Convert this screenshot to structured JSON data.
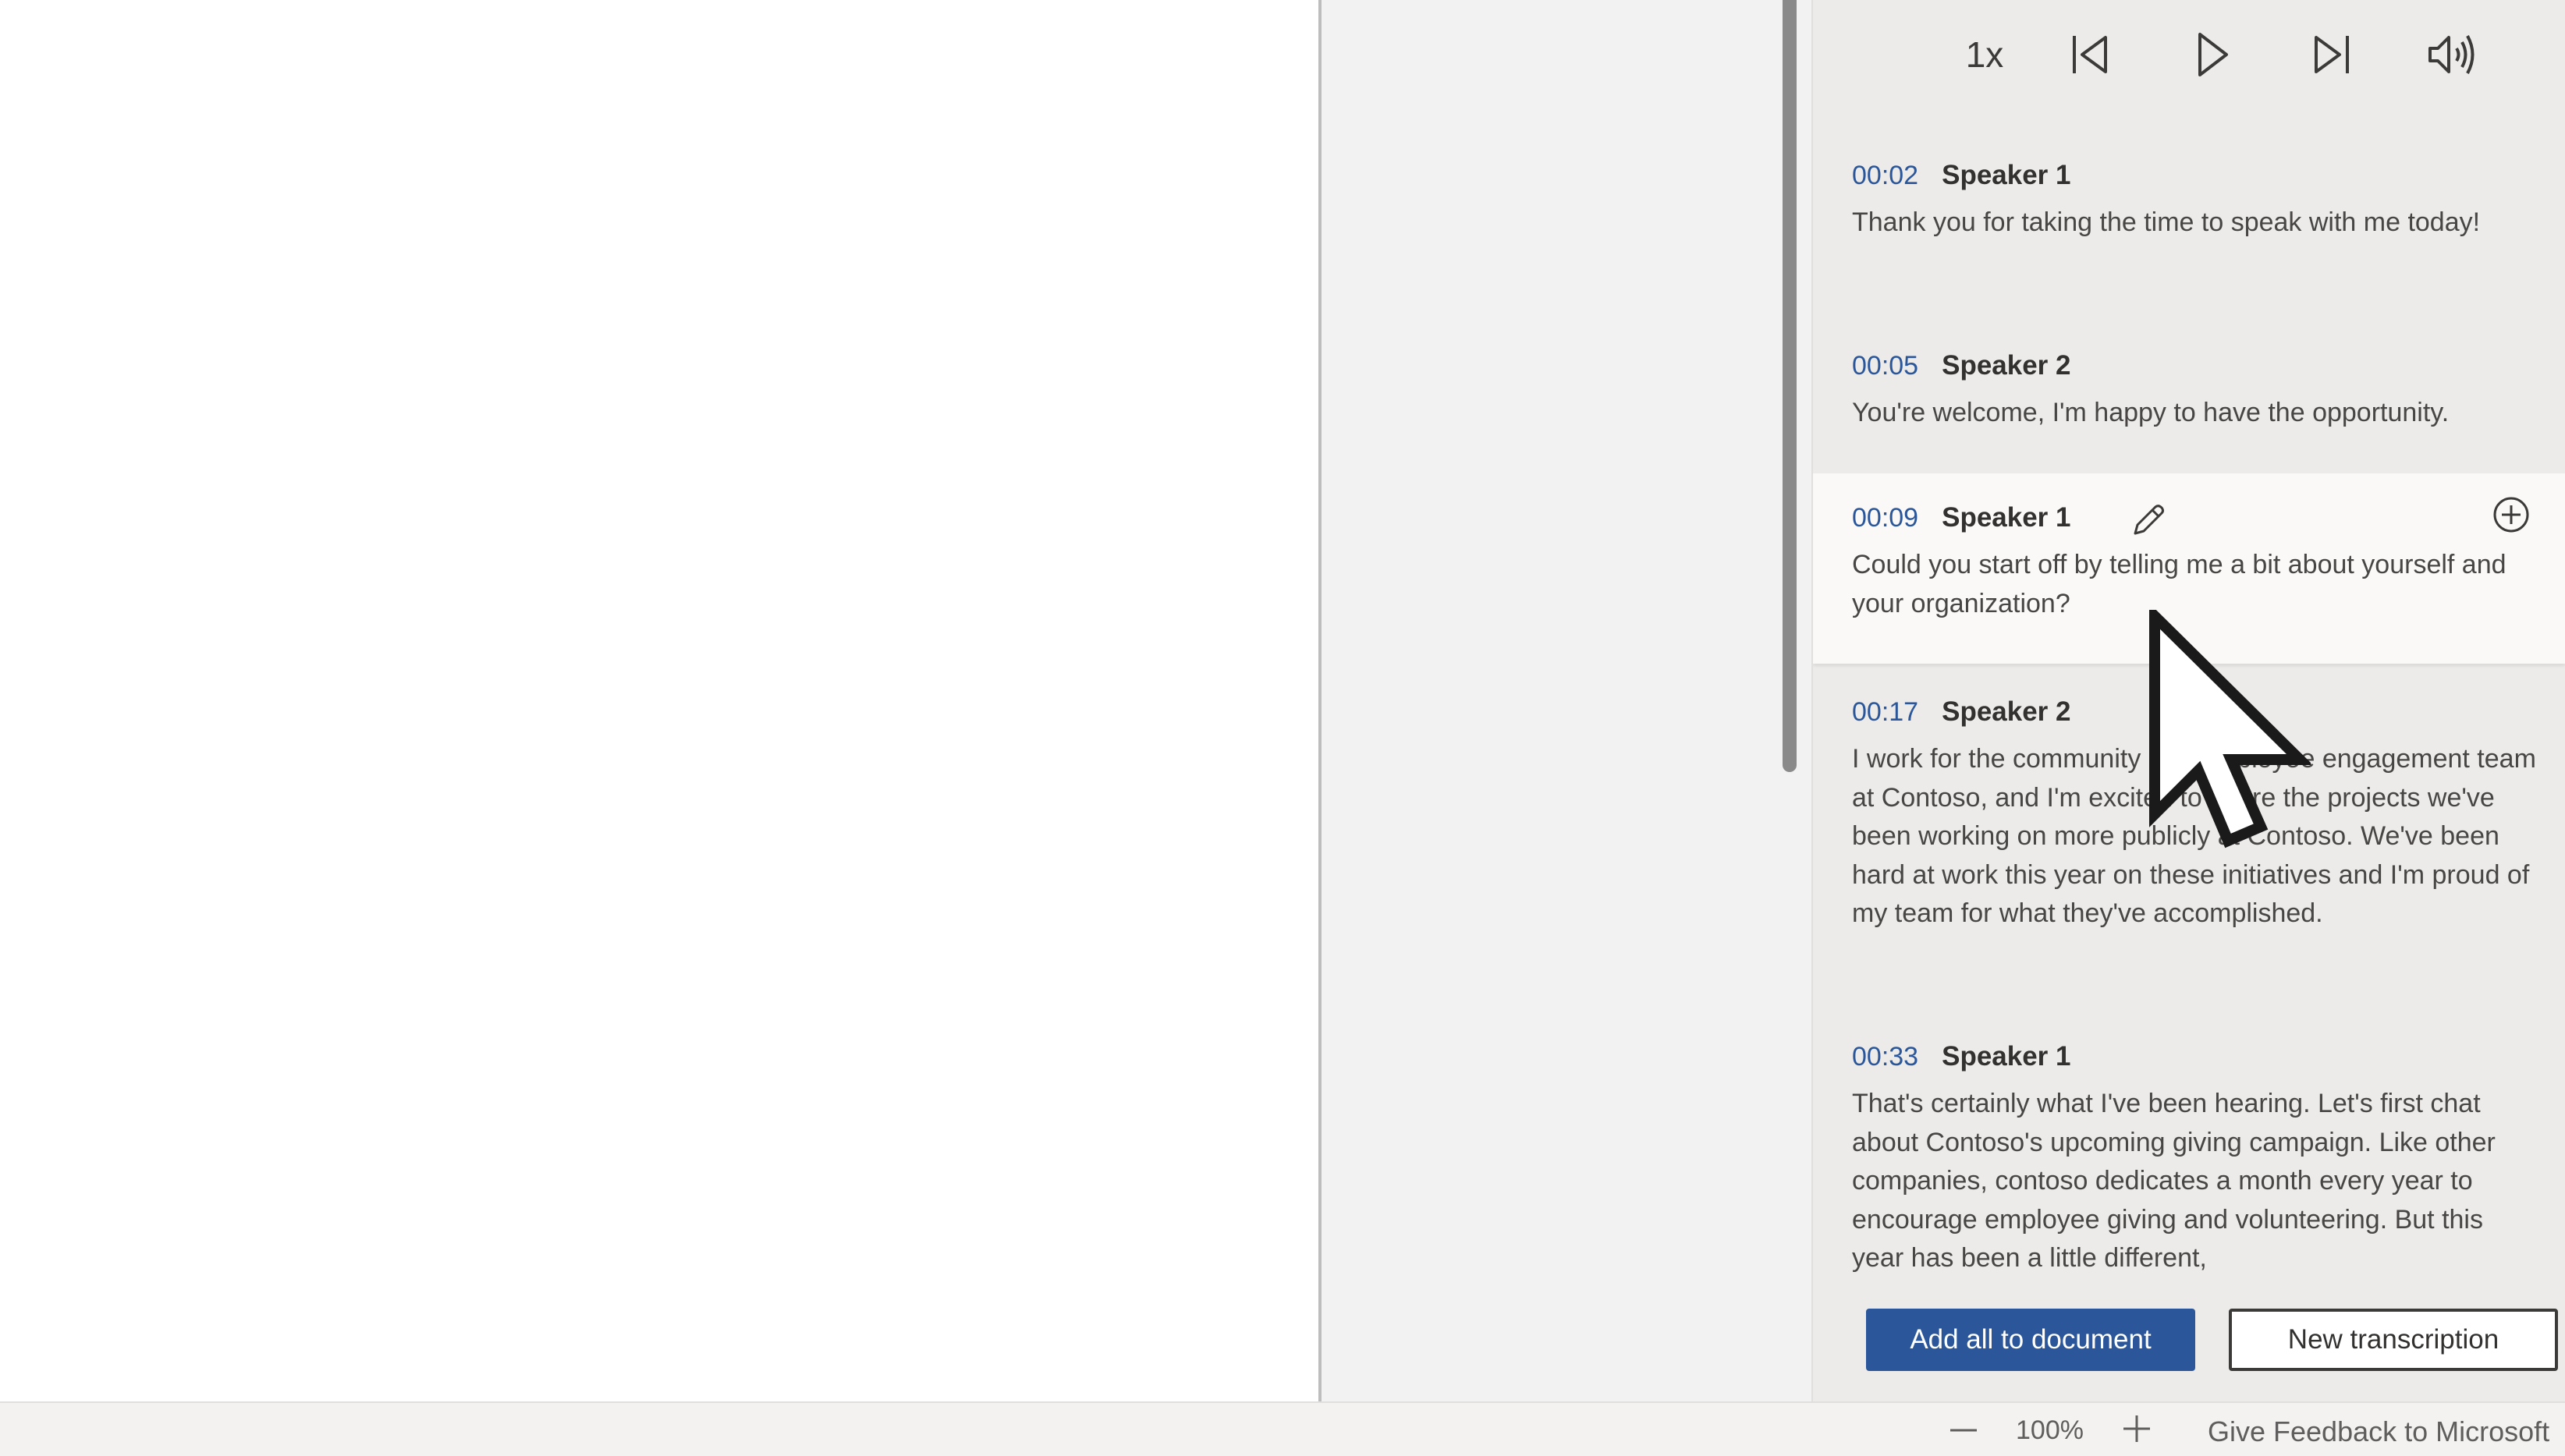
{
  "player": {
    "speed_label": "1x",
    "controls": [
      "skip-back",
      "play",
      "skip-forward",
      "volume"
    ]
  },
  "transcript": {
    "entries": [
      {
        "timestamp": "00:02",
        "speaker": "Speaker 1",
        "text": "Thank you for taking the time to speak with me today!"
      },
      {
        "timestamp": "00:05",
        "speaker": "Speaker 2",
        "text": "You're welcome, I'm happy to have the opportunity."
      },
      {
        "timestamp": "00:09",
        "speaker": "Speaker 1",
        "text": "Could you start off by telling me a bit about yourself and your organization?"
      },
      {
        "timestamp": "00:17",
        "speaker": "Speaker 2",
        "text": "I work for the community and employee engagement team at Contoso, and I'm excited to share the projects we've been working on more publicly at Contoso. We've been hard at work this year on these initiatives and I'm proud of my team for what they've accomplished."
      },
      {
        "timestamp": "00:33",
        "speaker": "Speaker 1",
        "text": "That's certainly what I've been hearing. Let's first chat about Contoso's upcoming giving campaign. Like other companies, contoso dedicates a month every year to encourage employee giving and volunteering. But this year has been a little different,"
      }
    ],
    "highlighted_index": 2
  },
  "actions": {
    "add_all_label": "Add all to document",
    "new_transcription_label": "New transcription"
  },
  "statusbar": {
    "zoom_level": "100%",
    "feedback_label": "Give Feedback to Microsoft"
  },
  "colors": {
    "accent": "#2b579a",
    "timestamp": "#2b579a",
    "pane_bg": "#edebe9",
    "highlight_bg": "#faf9f8"
  }
}
